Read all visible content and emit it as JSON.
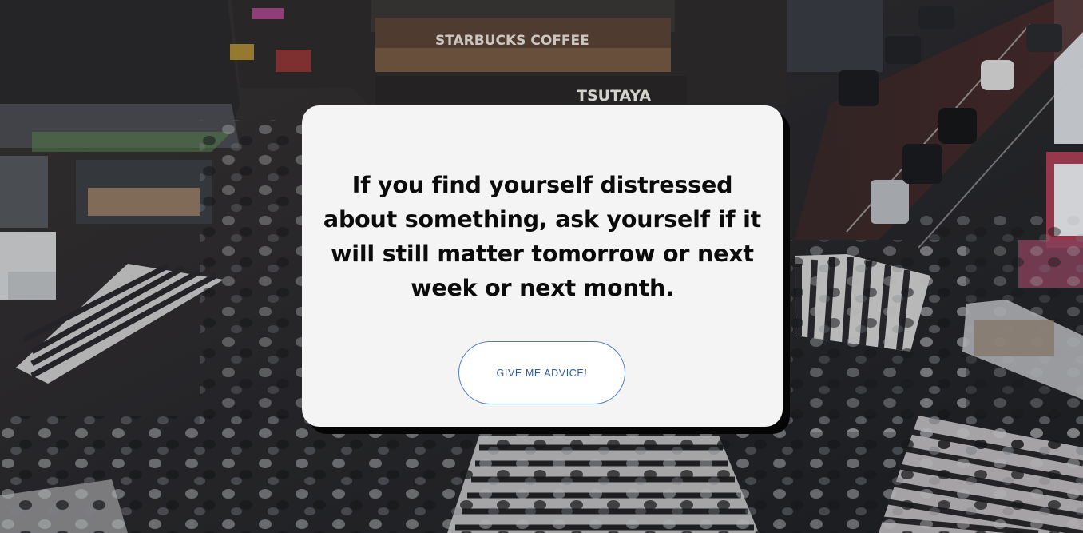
{
  "advice": {
    "quote": "If you find yourself distressed about something, ask yourself if it will still matter tomorrow or next week or next month.",
    "button_label": "GIVE ME ADVICE!"
  },
  "background": {
    "signs": [
      "STARBUCKS COFFEE",
      "TSUTAYA"
    ]
  }
}
